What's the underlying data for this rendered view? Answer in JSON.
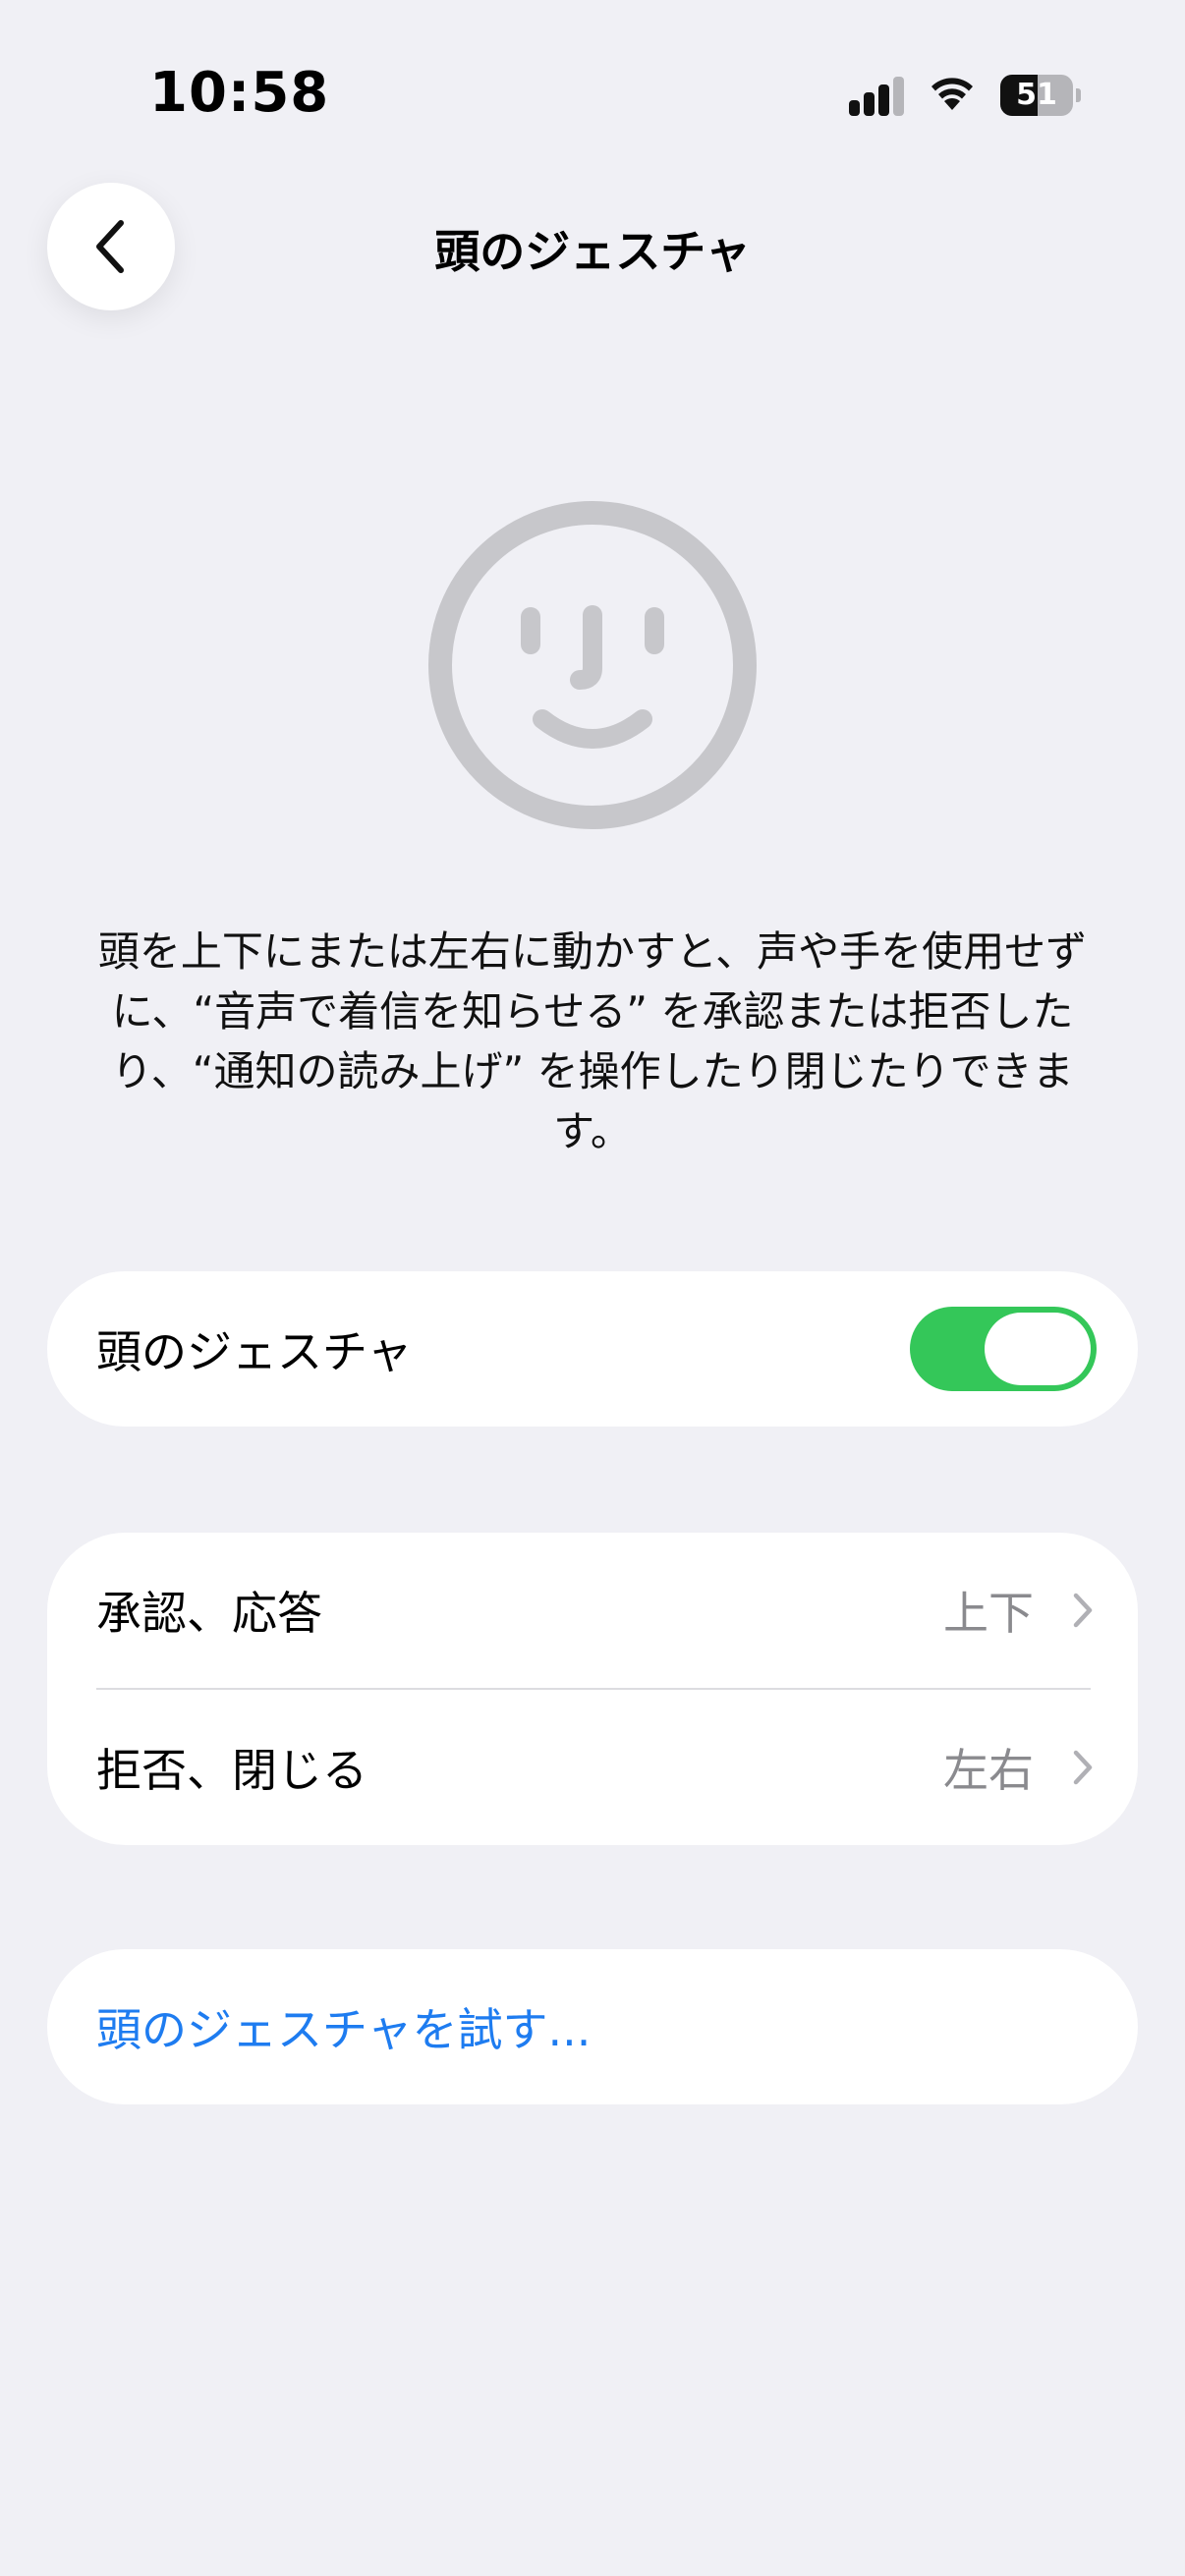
{
  "status_bar": {
    "time": "10:58",
    "battery_level": "51",
    "battery_fraction": 0.51,
    "icons": [
      "cellular-signal-icon",
      "wifi-icon",
      "battery-icon"
    ]
  },
  "nav": {
    "title": "頭のジェスチャ",
    "back_icon": "chevron-left-icon"
  },
  "illustration": {
    "icon": "face-icon"
  },
  "description": "頭を上下にまたは左右に動かすと、声や手を使用せずに、“音声で着信を知らせる” を承認または拒否したり、“通知の読み上げ” を操作したり閉じたりできます。",
  "toggle_row": {
    "label": "頭のジェスチャ",
    "enabled": true
  },
  "options": [
    {
      "label": "承認、応答",
      "value": "上下"
    },
    {
      "label": "拒否、閉じる",
      "value": "左右"
    }
  ],
  "try_link": {
    "label": "頭のジェスチャを試す..."
  },
  "colors": {
    "background": "#f0f0f5",
    "toggle_on": "#34c759",
    "link": "#1e7cf0",
    "secondary_text": "#8a8a8e",
    "face_gray": "#c7c7cb"
  }
}
